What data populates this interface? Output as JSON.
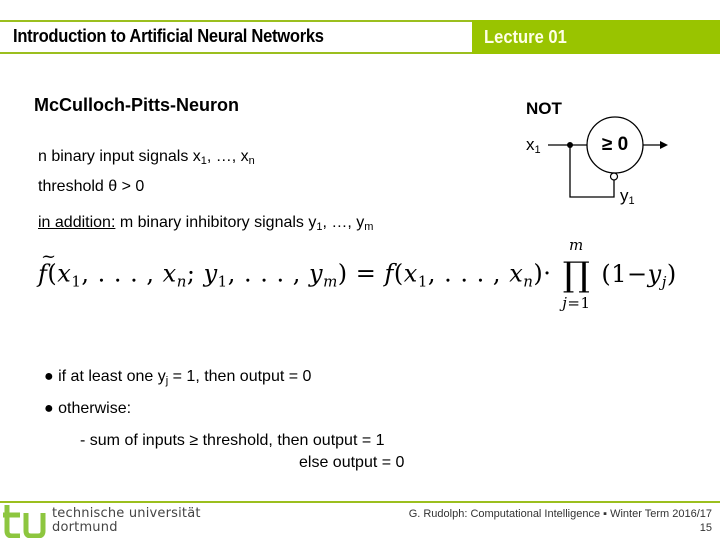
{
  "header": {
    "course_title": "Introduction to Artificial Neural Networks",
    "lecture_label": "Lecture 01"
  },
  "slide": {
    "heading": "McCulloch-Pitts-Neuron",
    "inputs_line": {
      "prefix": "n binary input signals x",
      "sub1": "1",
      "middle": ", …, x",
      "subn": "n"
    },
    "threshold_line": "threshold θ > 0",
    "inhibitory_line": {
      "label": "in addition:",
      "prefix": " m binary inhibitory signals y",
      "sub1": "1",
      "middle": ", …, y",
      "subm": "m"
    },
    "formula": {
      "lhs_fn": "f",
      "rhs_fn": "f",
      "prod_upper": "m",
      "prod_lower": "j=1",
      "factor": "(1−y",
      "factor_sub": "j",
      "factor_close": ")"
    },
    "bullets": [
      {
        "prefix": "● if at least one y",
        "sub": "j",
        "suffix": " = 1, then output = 0"
      },
      {
        "text": "● otherwise:"
      }
    ],
    "rule_line1": "- sum of inputs ≥ threshold, then output = 1",
    "rule_line2": "else  output = 0"
  },
  "diagram": {
    "title": "NOT",
    "input_label": "x",
    "input_sub": "1",
    "threshold_label": "≥ 0",
    "inhibitory_label": "y",
    "inhibitory_sub": "1"
  },
  "footer": {
    "university_line1": "technische universität",
    "university_line2": "dortmund",
    "credit": "G. Rudolph: Computational Intelligence ▪ Winter Term 2016/17",
    "page_number": "15"
  },
  "colors": {
    "accent_green": "#99C400",
    "line_green": "#9BBF1E"
  }
}
